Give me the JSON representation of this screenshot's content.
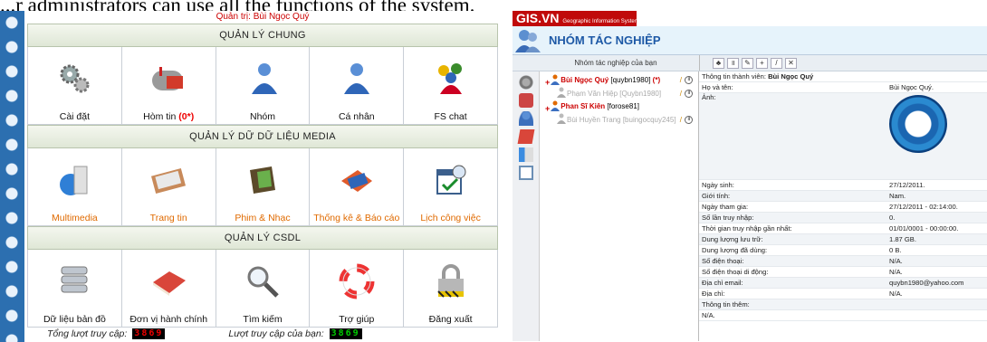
{
  "caption": "...r administrators can use all the functions of the system.",
  "left": {
    "admin_label": "Quản trị: Bùi Ngọc Quý",
    "sections": [
      {
        "title": "QUẢN LÝ CHUNG",
        "items": [
          {
            "label": "Cài đặt",
            "icon": "gears-icon",
            "color": "#111"
          },
          {
            "label": "Hòm tin",
            "badge": "(0*)",
            "icon": "mailbox-icon",
            "color": "#111"
          },
          {
            "label": "Nhóm",
            "icon": "group-user-icon",
            "color": "#111"
          },
          {
            "label": "Cá nhân",
            "icon": "user-icon",
            "color": "#111"
          },
          {
            "label": "FS chat",
            "icon": "chat-users-icon",
            "color": "#111"
          }
        ]
      },
      {
        "title": "QUẢN LÝ DỮ DỮ LIỆU MEDIA",
        "items": [
          {
            "label": "Multimedia",
            "icon": "multimedia-icon",
            "color": "#e06a00"
          },
          {
            "label": "Trang tin",
            "icon": "news-icon",
            "color": "#e06a00"
          },
          {
            "label": "Phim & Nhạc",
            "icon": "film-music-icon",
            "color": "#e06a00"
          },
          {
            "label": "Thống kê & Báo cáo",
            "icon": "report-icon",
            "color": "#e06a00"
          },
          {
            "label": "Lịch công việc",
            "icon": "calendar-icon",
            "color": "#e06a00"
          }
        ]
      },
      {
        "title": "QUẢN LÝ CSDL",
        "items": [
          {
            "label": "Dữ liệu bản đồ",
            "icon": "database-icon",
            "color": "#111"
          },
          {
            "label": "Đơn vị hành chính",
            "icon": "book-icon",
            "color": "#111"
          },
          {
            "label": "Tìm kiếm",
            "icon": "magnifier-icon",
            "color": "#111"
          },
          {
            "label": "Trợ giúp",
            "icon": "lifebuoy-icon",
            "color": "#111"
          },
          {
            "label": "Đăng xuất",
            "icon": "padlock-icon",
            "color": "#111"
          }
        ]
      }
    ],
    "stats": {
      "total_label": "Tổng lượt truy cập:",
      "total_value": "3869",
      "yours_label": "Lượt truy cập của bạn:",
      "yours_value": "3869"
    }
  },
  "right": {
    "brand": "GIS.VN",
    "brand_sub": "Geographic Information System",
    "page_title": "NHÓM TÁC NGHIỆP",
    "tree_header": "Nhóm tác nghiệp của bạn",
    "tree": [
      {
        "name": "Bùi Ngọc Quý",
        "user": "[quybn1980]",
        "flag": "(*)",
        "level": 0,
        "style": "bn"
      },
      {
        "name": "Phạm Văn Hiệp",
        "user": "[Quybn1980]",
        "level": 1,
        "style": "gr"
      },
      {
        "name": "Phan Sĩ Kiên",
        "user": "[forose81]",
        "level": 0,
        "style": "bn"
      },
      {
        "name": "Bùi Huyền Trang",
        "user": "[buingocquy245]",
        "level": 1,
        "style": "gr"
      }
    ],
    "detail_title_label": "Thông tin thành viên:",
    "detail_title_name": "Bùi Ngọc Quý",
    "fields": [
      {
        "k": "Họ và tên:",
        "v": "Bùi Ngọc Quý."
      },
      {
        "k": "Ảnh:",
        "v": ""
      },
      {
        "k": "Ngày sinh:",
        "v": "27/12/2011."
      },
      {
        "k": "Giới tính:",
        "v": "Nam."
      },
      {
        "k": "Ngày tham gia:",
        "v": "27/12/2011 - 02:14:00."
      },
      {
        "k": "Số lần truy nhập:",
        "v": "0."
      },
      {
        "k": "Thời gian truy nhập gần nhất:",
        "v": "01/01/0001 - 00:00:00."
      },
      {
        "k": "Dung lượng lưu trữ:",
        "v": "1.87 GB."
      },
      {
        "k": "Dung lượng đã dùng:",
        "v": "0 B."
      },
      {
        "k": "Số điện thoại:",
        "v": "N/A."
      },
      {
        "k": "Số điện thoại di động:",
        "v": "N/A."
      },
      {
        "k": "Địa chỉ email:",
        "v": "quybn1980@yahoo.com"
      },
      {
        "k": "Địa chỉ:",
        "v": "N/A."
      },
      {
        "k": "Thông tin thêm:",
        "v": ""
      },
      {
        "k": "N/A.",
        "v": ""
      }
    ]
  }
}
